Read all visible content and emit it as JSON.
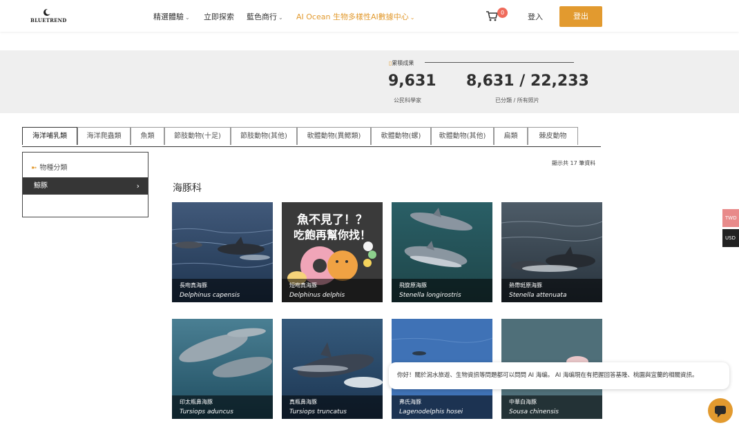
{
  "logo": {
    "text": "BLUETREND"
  },
  "nav": [
    {
      "label": "精選體驗",
      "dropdown": true,
      "accent": false
    },
    {
      "label": "立即探索",
      "dropdown": false,
      "accent": false
    },
    {
      "label": "藍色商行",
      "dropdown": true,
      "accent": false
    },
    {
      "label": "AI Ocean 生物多樣性AI數據中心",
      "dropdown": true,
      "accent": true
    }
  ],
  "cart": {
    "count": "0"
  },
  "auth": {
    "login": "登入",
    "logout": "登出"
  },
  "stats": {
    "title": "累積成果",
    "citizens_value": "9,631",
    "citizens_label": "公民科學家",
    "photos_value": "8,631 / 22,233",
    "photos_label": "已分類 / 所有照片"
  },
  "tabs": [
    "海洋哺乳類",
    "海洋爬蟲類",
    "魚類",
    "節肢動物(十足)",
    "節肢動物(其他)",
    "軟體動物(異鰓類)",
    "軟體動物(螺)",
    "軟體動物(其他)",
    "扁類",
    "棘皮動物"
  ],
  "sidebar": {
    "heading": "物種分類",
    "items": [
      {
        "label": "鯨豚"
      }
    ]
  },
  "results": {
    "count_text": "顯示共 17 筆資料",
    "family": "海豚科"
  },
  "poster_text": {
    "line1": "魚不見了！？",
    "line2": "吃飽再幫你找！"
  },
  "cards": [
    {
      "zh": "長吻真海豚",
      "sci": "Delphinus capensis"
    },
    {
      "zh": "短吻真海豚",
      "sci": "Delphinus delphis"
    },
    {
      "zh": "飛旋原海豚",
      "sci": "Stenella longirostris"
    },
    {
      "zh": "熱帶斑原海豚",
      "sci": "Stenella attenuata"
    },
    {
      "zh": "印太瓶鼻海豚",
      "sci": "Tursiops aduncus"
    },
    {
      "zh": "真瓶鼻海豚",
      "sci": "Tursiops truncatus"
    },
    {
      "zh": "弗氏海豚",
      "sci": "Lagenodelphis hosei"
    },
    {
      "zh": "中華白海豚",
      "sci": "Sousa chinensis"
    }
  ],
  "currency": [
    "TWD",
    "USD"
  ],
  "chat": {
    "message": "你好！關於潟水旅遊、生物資訊等問題都可以問問 AI 海编。 AI 海编現在有把握回答基隆、桃園與宜蘭的相關資訊。"
  },
  "colors": {
    "accent": "#e29a2f",
    "dark": "#363636",
    "band": "#efefef",
    "twd": "#e88a8a",
    "usd": "#222222"
  }
}
